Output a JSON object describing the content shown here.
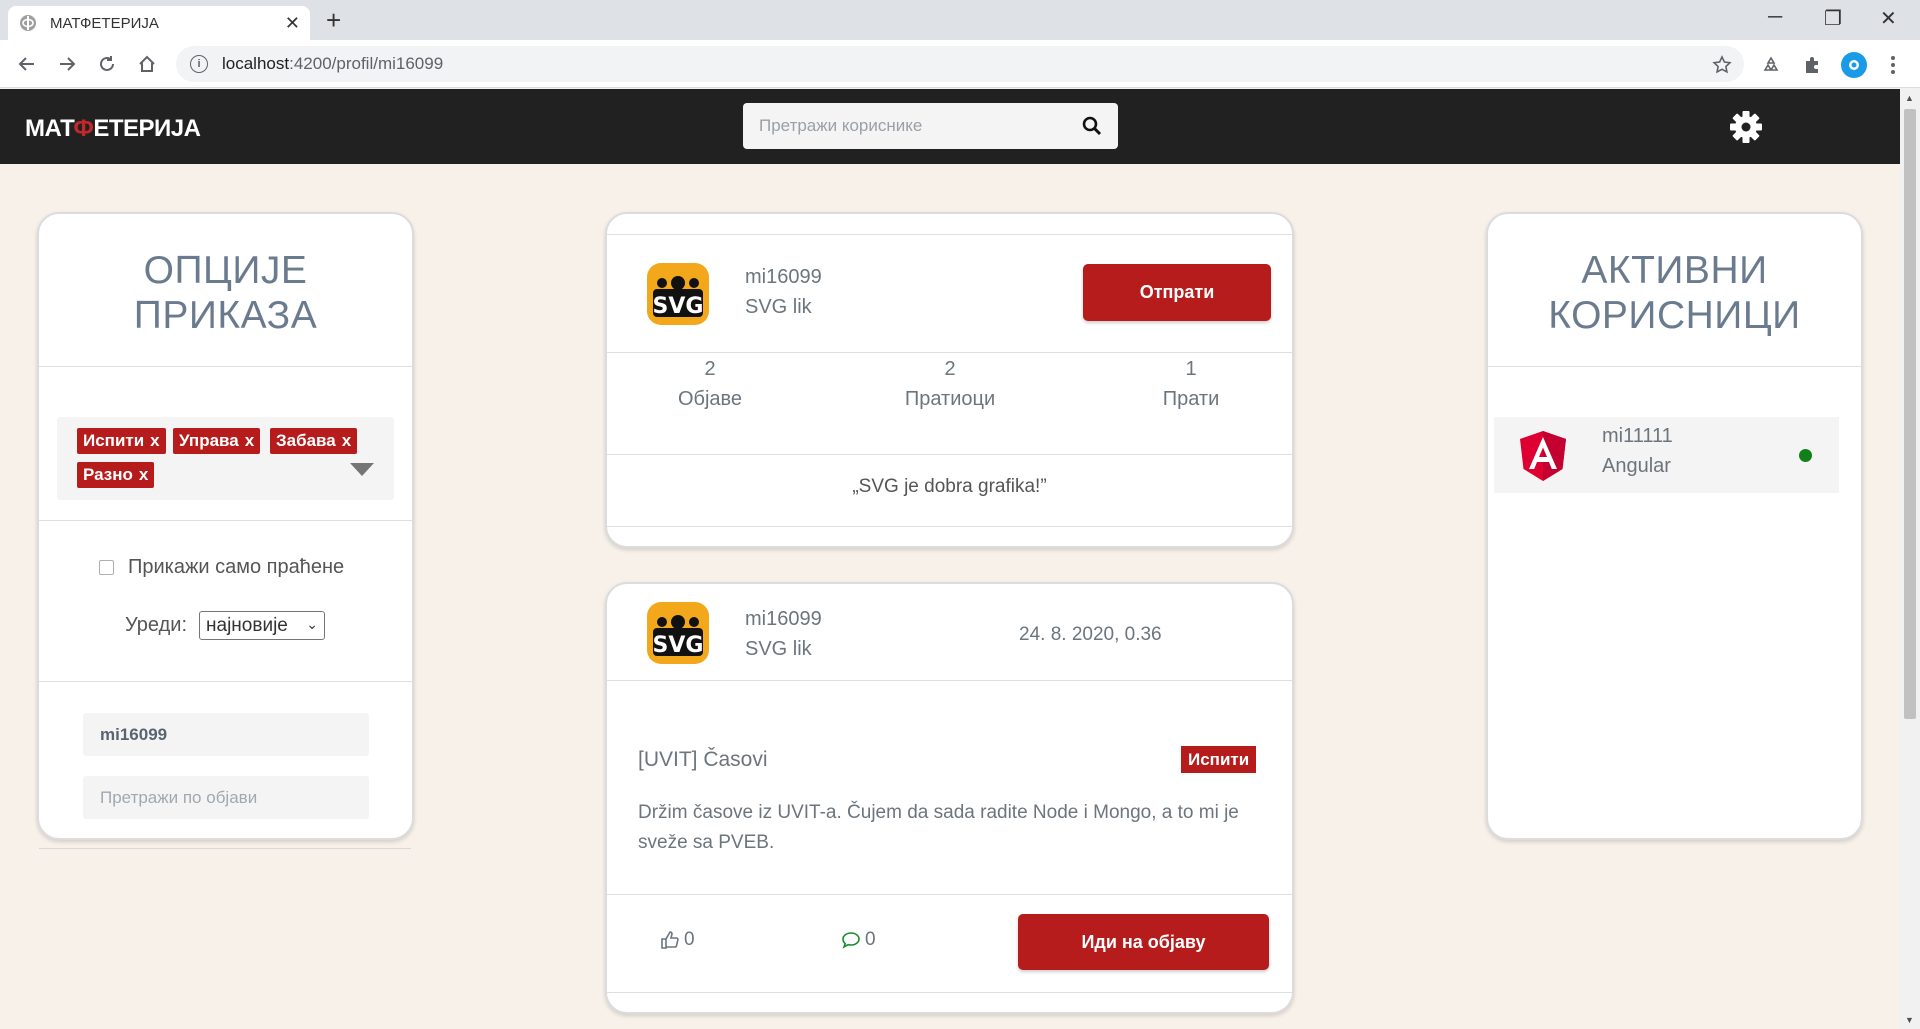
{
  "browser": {
    "tab_title": "МАТФЕТЕРИЈА",
    "url_host": "localhost",
    "url_path": ":4200/profil/mi16099"
  },
  "header": {
    "brand_left": "МАТ",
    "brand_phi": "Ф",
    "brand_right": "ЕТЕРИЈА",
    "search_placeholder": "Претражи кориснике"
  },
  "left_panel": {
    "title_line1": "ОПЦИЈЕ",
    "title_line2": "ПРИКАЗА",
    "chips": [
      "Испити",
      "Управа",
      "Забава",
      "Разно"
    ],
    "chip_remove": "x",
    "checkbox_label": "Прикажи само праћене",
    "sort_label": "Уреди:",
    "sort_value": "најновије",
    "user_filter_value": "mi16099",
    "post_search_placeholder": "Претражи по објави"
  },
  "profile": {
    "username": "mi16099",
    "avatar_label": "SVG lik",
    "unfollow_button": "Отпрати",
    "stats": [
      {
        "count": "2",
        "label": "Објаве"
      },
      {
        "count": "2",
        "label": "Пратиоци"
      },
      {
        "count": "1",
        "label": "Прати"
      }
    ],
    "quote": "„SVG je dobra grafika!”"
  },
  "post": {
    "username": "mi16099",
    "avatar_label": "SVG lik",
    "date": "24. 8. 2020, 0.36",
    "title": "[UVIT] Časovi",
    "tag": "Испити",
    "body": "Držim časove iz UVIT-a. Čujem da sada radite Node i Mongo, a to mi je sveže sa PVEB.",
    "likes": "0",
    "comments": "0",
    "open_button": "Иди на објаву"
  },
  "right_panel": {
    "title_line1": "АКТИВНИ",
    "title_line2": "КОРИСНИЦИ",
    "users": [
      {
        "username": "mi11111",
        "label": "Angular",
        "status_color": "#11801a"
      }
    ]
  },
  "colors": {
    "accent": "#b71c1c",
    "header_bg": "#212121",
    "page_bg": "#f8f1ea"
  }
}
